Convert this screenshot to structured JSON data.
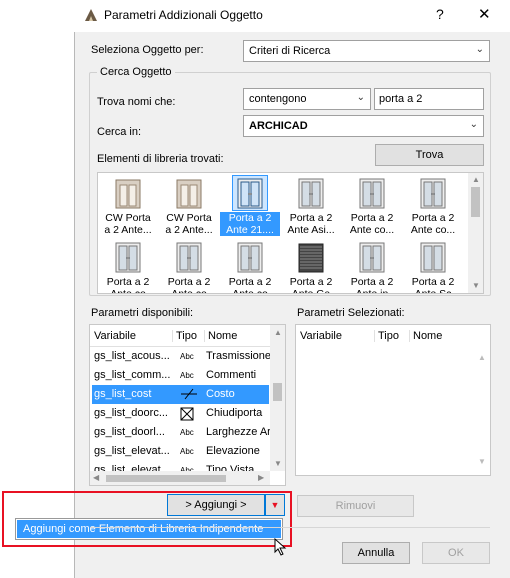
{
  "dialog": {
    "title": "Parametri Addizionali Oggetto",
    "help_symbol": "?",
    "close_symbol": "✕"
  },
  "select_object": {
    "label": "Seleziona Oggetto per:",
    "value": "Criteri di Ricerca"
  },
  "search": {
    "group_title": "Cerca Oggetto",
    "find_names_label": "Trova nomi che:",
    "condition_value": "contengono",
    "query_value": "porta a 2",
    "search_in_label": "Cerca in:",
    "search_in_value": "ARCHICAD",
    "found_label": "Elementi di libreria trovati:",
    "find_button": "Trova"
  },
  "library_items": [
    {
      "name": "CW Porta\na 2 Ante...",
      "icon": "cw-door-icon",
      "selected": false
    },
    {
      "name": "CW Porta\na 2 Ante...",
      "icon": "cw-door-icon",
      "selected": false
    },
    {
      "name": "Porta a 2\nAnte 21....",
      "icon": "double-door-icon",
      "selected": true
    },
    {
      "name": "Porta a 2\nAnte Asi...",
      "icon": "double-door-icon",
      "selected": false
    },
    {
      "name": "Porta a 2\nAnte co...",
      "icon": "double-door-icon",
      "selected": false
    },
    {
      "name": "Porta a 2\nAnte co...",
      "icon": "double-door-icon",
      "selected": false
    },
    {
      "name": "Porta a 2\nAnte co",
      "icon": "double-door-icon",
      "selected": false
    },
    {
      "name": "Porta a 2\nAnte co",
      "icon": "double-door-icon",
      "selected": false
    },
    {
      "name": "Porta a 2\nAnte co",
      "icon": "double-door-icon",
      "selected": false
    },
    {
      "name": "Porta a 2\nAnte Ga",
      "icon": "garage-door-icon",
      "selected": false
    },
    {
      "name": "Porta a 2\nAnte in",
      "icon": "double-door-icon",
      "selected": false
    },
    {
      "name": "Porta a 2\nAnte Sc",
      "icon": "sliding-door-icon",
      "selected": false
    }
  ],
  "available_params": {
    "label": "Parametri disponibili:",
    "col_variable": "Variabile",
    "col_type": "Tipo",
    "col_name": "Nome",
    "rows": [
      {
        "variable": "gs_list_acous...",
        "type": "Abc",
        "name": "Trasmissione",
        "selected": false
      },
      {
        "variable": "gs_list_comm...",
        "type": "Abc",
        "name": "Commenti",
        "selected": false
      },
      {
        "variable": "gs_list_cost",
        "type": "cost-icon",
        "name": "Costo",
        "selected": true
      },
      {
        "variable": "gs_list_doorc...",
        "type": "checkbox-icon",
        "name": "Chiudiporta",
        "selected": false
      },
      {
        "variable": "gs_list_doorl...",
        "type": "Abc",
        "name": "Larghezze Ar",
        "selected": false
      },
      {
        "variable": "gs_list_elevat...",
        "type": "Abc",
        "name": "Elevazione",
        "selected": false
      },
      {
        "variable": "gs_list_elevat...",
        "type": "Abc",
        "name": "Tipo Vista",
        "selected": false
      }
    ]
  },
  "selected_params": {
    "label": "Parametri Selezionati:",
    "col_variable": "Variabile",
    "col_type": "Tipo",
    "col_name": "Nome"
  },
  "actions": {
    "add_button": "> Aggiungi >",
    "remove_button": "Rimuovi",
    "dropdown_item": "Aggiungi come Elemento di Libreria Indipendente",
    "cancel_button": "Annulla",
    "ok_button": "OK"
  },
  "colors": {
    "selection": "#3399ff",
    "highlight_red": "#e81123",
    "focus_blue": "#0078d7"
  }
}
